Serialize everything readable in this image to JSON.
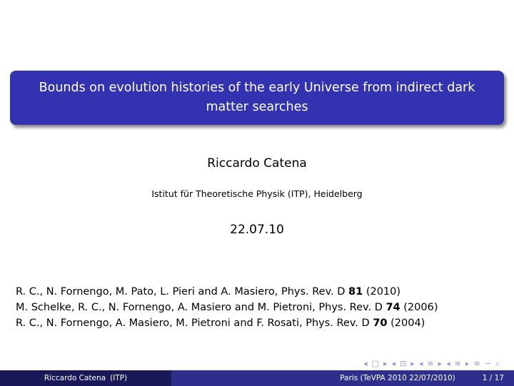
{
  "slide": {
    "title_line1": "Bounds on evolution histories of the early Universe from indirect dark",
    "title_line2": "matter searches",
    "author": "Riccardo Catena",
    "institute": "Istitut für Theoretische Physik (ITP), Heidelberg",
    "date": "22.07.10"
  },
  "references": [
    {
      "pre": "R. C., N. Fornengo, M. Pato, L. Pieri and A. Masiero, Phys. Rev. D ",
      "vol": "81",
      "post": " (2010)"
    },
    {
      "pre": "M. Schelke, R. C., N. Fornengo, A. Masiero and M. Pietroni, Phys. Rev. D ",
      "vol": "74",
      "post": " (2006)"
    },
    {
      "pre": "R. C., N. Fornengo, A. Masiero, M. Pietroni and F. Rosati, Phys. Rev. D ",
      "vol": "70",
      "post": " (2004)"
    }
  ],
  "navigation": {
    "icons": [
      "nav-left-arrow-icon",
      "nav-frame-icon",
      "nav-right-arrow-icon",
      "nav-subsection-icon",
      "nav-section-icon",
      "nav-align-icon",
      "nav-search-icon"
    ],
    "glyphs": [
      "◂",
      "□",
      "▸",
      "◂",
      "⊡",
      "▸",
      "◂",
      "≡",
      "▸",
      "◂",
      "≡",
      "▸",
      "≡",
      "∽",
      "⌕"
    ]
  },
  "footer": {
    "author": "Riccardo Catena",
    "institute_short": "(ITP)",
    "event": "Paris (TeVPA 2010 22/07/2010)",
    "page": "1 / 17"
  }
}
